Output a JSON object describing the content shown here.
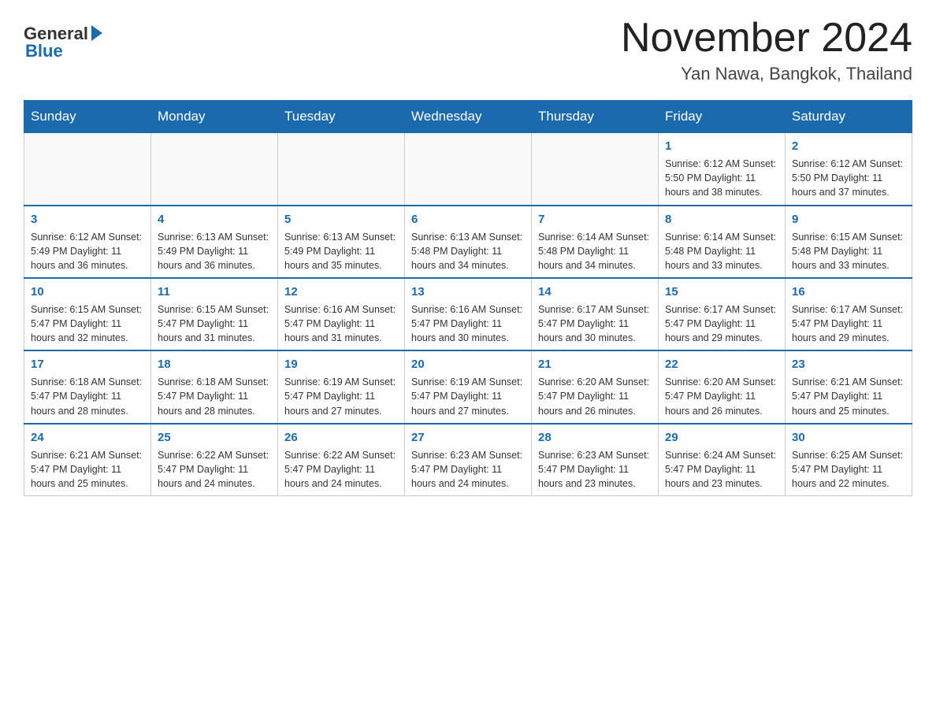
{
  "header": {
    "logo_general": "General",
    "logo_blue": "Blue",
    "month_title": "November 2024",
    "location": "Yan Nawa, Bangkok, Thailand"
  },
  "weekdays": [
    "Sunday",
    "Monday",
    "Tuesday",
    "Wednesday",
    "Thursday",
    "Friday",
    "Saturday"
  ],
  "weeks": [
    [
      {
        "day": "",
        "info": ""
      },
      {
        "day": "",
        "info": ""
      },
      {
        "day": "",
        "info": ""
      },
      {
        "day": "",
        "info": ""
      },
      {
        "day": "",
        "info": ""
      },
      {
        "day": "1",
        "info": "Sunrise: 6:12 AM\nSunset: 5:50 PM\nDaylight: 11 hours and 38 minutes."
      },
      {
        "day": "2",
        "info": "Sunrise: 6:12 AM\nSunset: 5:50 PM\nDaylight: 11 hours and 37 minutes."
      }
    ],
    [
      {
        "day": "3",
        "info": "Sunrise: 6:12 AM\nSunset: 5:49 PM\nDaylight: 11 hours and 36 minutes."
      },
      {
        "day": "4",
        "info": "Sunrise: 6:13 AM\nSunset: 5:49 PM\nDaylight: 11 hours and 36 minutes."
      },
      {
        "day": "5",
        "info": "Sunrise: 6:13 AM\nSunset: 5:49 PM\nDaylight: 11 hours and 35 minutes."
      },
      {
        "day": "6",
        "info": "Sunrise: 6:13 AM\nSunset: 5:48 PM\nDaylight: 11 hours and 34 minutes."
      },
      {
        "day": "7",
        "info": "Sunrise: 6:14 AM\nSunset: 5:48 PM\nDaylight: 11 hours and 34 minutes."
      },
      {
        "day": "8",
        "info": "Sunrise: 6:14 AM\nSunset: 5:48 PM\nDaylight: 11 hours and 33 minutes."
      },
      {
        "day": "9",
        "info": "Sunrise: 6:15 AM\nSunset: 5:48 PM\nDaylight: 11 hours and 33 minutes."
      }
    ],
    [
      {
        "day": "10",
        "info": "Sunrise: 6:15 AM\nSunset: 5:47 PM\nDaylight: 11 hours and 32 minutes."
      },
      {
        "day": "11",
        "info": "Sunrise: 6:15 AM\nSunset: 5:47 PM\nDaylight: 11 hours and 31 minutes."
      },
      {
        "day": "12",
        "info": "Sunrise: 6:16 AM\nSunset: 5:47 PM\nDaylight: 11 hours and 31 minutes."
      },
      {
        "day": "13",
        "info": "Sunrise: 6:16 AM\nSunset: 5:47 PM\nDaylight: 11 hours and 30 minutes."
      },
      {
        "day": "14",
        "info": "Sunrise: 6:17 AM\nSunset: 5:47 PM\nDaylight: 11 hours and 30 minutes."
      },
      {
        "day": "15",
        "info": "Sunrise: 6:17 AM\nSunset: 5:47 PM\nDaylight: 11 hours and 29 minutes."
      },
      {
        "day": "16",
        "info": "Sunrise: 6:17 AM\nSunset: 5:47 PM\nDaylight: 11 hours and 29 minutes."
      }
    ],
    [
      {
        "day": "17",
        "info": "Sunrise: 6:18 AM\nSunset: 5:47 PM\nDaylight: 11 hours and 28 minutes."
      },
      {
        "day": "18",
        "info": "Sunrise: 6:18 AM\nSunset: 5:47 PM\nDaylight: 11 hours and 28 minutes."
      },
      {
        "day": "19",
        "info": "Sunrise: 6:19 AM\nSunset: 5:47 PM\nDaylight: 11 hours and 27 minutes."
      },
      {
        "day": "20",
        "info": "Sunrise: 6:19 AM\nSunset: 5:47 PM\nDaylight: 11 hours and 27 minutes."
      },
      {
        "day": "21",
        "info": "Sunrise: 6:20 AM\nSunset: 5:47 PM\nDaylight: 11 hours and 26 minutes."
      },
      {
        "day": "22",
        "info": "Sunrise: 6:20 AM\nSunset: 5:47 PM\nDaylight: 11 hours and 26 minutes."
      },
      {
        "day": "23",
        "info": "Sunrise: 6:21 AM\nSunset: 5:47 PM\nDaylight: 11 hours and 25 minutes."
      }
    ],
    [
      {
        "day": "24",
        "info": "Sunrise: 6:21 AM\nSunset: 5:47 PM\nDaylight: 11 hours and 25 minutes."
      },
      {
        "day": "25",
        "info": "Sunrise: 6:22 AM\nSunset: 5:47 PM\nDaylight: 11 hours and 24 minutes."
      },
      {
        "day": "26",
        "info": "Sunrise: 6:22 AM\nSunset: 5:47 PM\nDaylight: 11 hours and 24 minutes."
      },
      {
        "day": "27",
        "info": "Sunrise: 6:23 AM\nSunset: 5:47 PM\nDaylight: 11 hours and 24 minutes."
      },
      {
        "day": "28",
        "info": "Sunrise: 6:23 AM\nSunset: 5:47 PM\nDaylight: 11 hours and 23 minutes."
      },
      {
        "day": "29",
        "info": "Sunrise: 6:24 AM\nSunset: 5:47 PM\nDaylight: 11 hours and 23 minutes."
      },
      {
        "day": "30",
        "info": "Sunrise: 6:25 AM\nSunset: 5:47 PM\nDaylight: 11 hours and 22 minutes."
      }
    ]
  ]
}
